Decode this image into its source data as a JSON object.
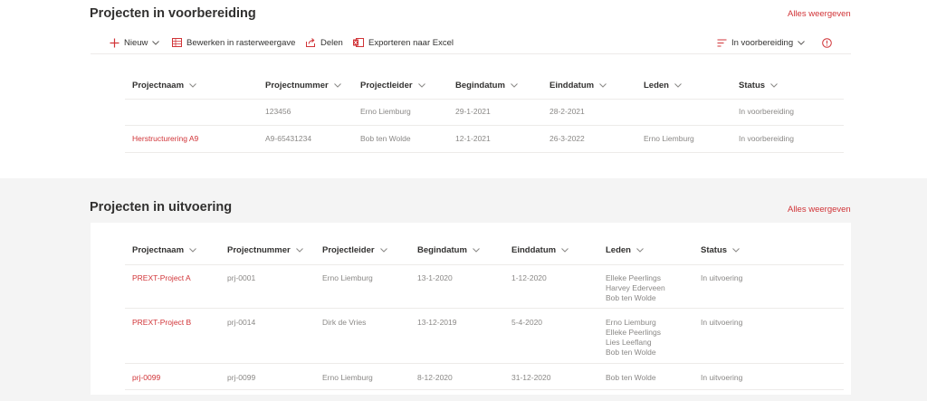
{
  "prep": {
    "title": "Projecten in voorbereiding",
    "see_all": "Alles weergeven",
    "commands": {
      "new": "Nieuw",
      "grid_edit": "Bewerken in rasterweergave",
      "share": "Delen",
      "export": "Exporteren naar Excel",
      "view": "In voorbereiding"
    },
    "columns": [
      "Projectnaam",
      "Projectnummer",
      "Projectleider",
      "Begindatum",
      "Einddatum",
      "Leden",
      "Status"
    ],
    "rows": [
      {
        "name": "",
        "number": "123456",
        "leader": "Erno Liemburg",
        "start": "29-1-2021",
        "end": "28-2-2021",
        "members": [],
        "status": "In voorbereiding"
      },
      {
        "name": "Herstructurering A9",
        "number": "A9-65431234",
        "leader": "Bob ten Wolde",
        "start": "12-1-2021",
        "end": "26-3-2022",
        "members": [
          "Erno Liemburg"
        ],
        "status": "In voorbereiding"
      }
    ]
  },
  "exec": {
    "title": "Projecten in uitvoering",
    "see_all": "Alles weergeven",
    "columns": [
      "Projectnaam",
      "Projectnummer",
      "Projectleider",
      "Begindatum",
      "Einddatum",
      "Leden",
      "Status"
    ],
    "rows": [
      {
        "name": "PREXT-Project A",
        "number": "prj-0001",
        "leader": "Erno Liemburg",
        "start": "13-1-2020",
        "end": "1-12-2020",
        "members": [
          "Elleke Peerlings",
          "Harvey Ederveen",
          "Bob ten Wolde"
        ],
        "status": "In uitvoering"
      },
      {
        "name": "PREXT-Project B",
        "number": "prj-0014",
        "leader": "Dirk de Vries",
        "start": "13-12-2019",
        "end": "5-4-2020",
        "members": [
          "Erno Liemburg",
          "Elleke Peerlings",
          "Lies Leeflang",
          "Bob ten Wolde"
        ],
        "status": "In uitvoering"
      },
      {
        "name": "prj-0099",
        "number": "prj-0099",
        "leader": "Erno Liemburg",
        "start": "8-12-2020",
        "end": "31-12-2020",
        "members": [
          "Bob ten Wolde"
        ],
        "status": "In uitvoering"
      }
    ]
  },
  "icons": {
    "new": "plus-icon",
    "grid_edit": "grid-icon",
    "share": "share-icon",
    "export": "excel-icon",
    "view": "view-lines-icon",
    "info": "info-icon",
    "sort": "chevron-down-icon"
  },
  "colors": {
    "accent": "#d13438",
    "muted_text": "#8a8886",
    "text": "#323130",
    "background": "#f4f4f4"
  }
}
